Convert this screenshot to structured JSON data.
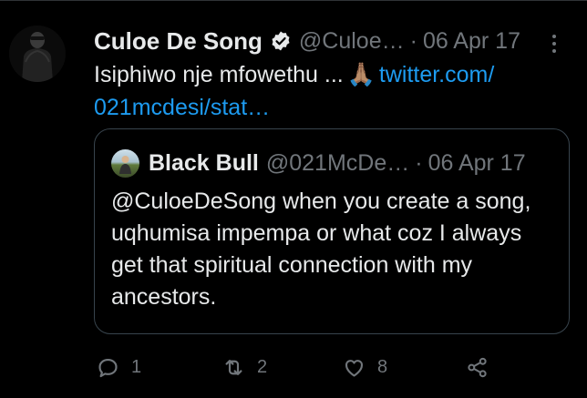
{
  "tweet": {
    "author_name": "Culoe De Song",
    "handle": "@Culoe…",
    "dot": "·",
    "date": "06 Apr 17",
    "text_before": "Isiphiwo nje mfowethu ...",
    "emoji": "🙏🏽",
    "link_line1": "twitter.com/",
    "link_line2": "021mcdesi/stat…",
    "avatar_icon": "user-avatar-icon",
    "verified_icon": "verified-badge-icon",
    "more_icon": "more-options-icon"
  },
  "quoted": {
    "author_name": "Black Bull",
    "handle": "@021McDe…",
    "dot": "·",
    "date": "06 Apr 17",
    "text": "@CuloeDeSong when you create a song, uqhumisa impempa or what coz I always get that spiritual connection with my ancestors.",
    "avatar_icon": "quoted-user-avatar-icon"
  },
  "actions": {
    "reply_count": "1",
    "retweet_count": "2",
    "like_count": "8",
    "reply_icon": "reply-icon",
    "retweet_icon": "retweet-icon",
    "like_icon": "like-icon",
    "share_icon": "share-icon"
  },
  "colors": {
    "background": "#000000",
    "text": "#e7e9ea",
    "muted": "#71767b",
    "link": "#1d9bf0",
    "border": "#38444d"
  }
}
